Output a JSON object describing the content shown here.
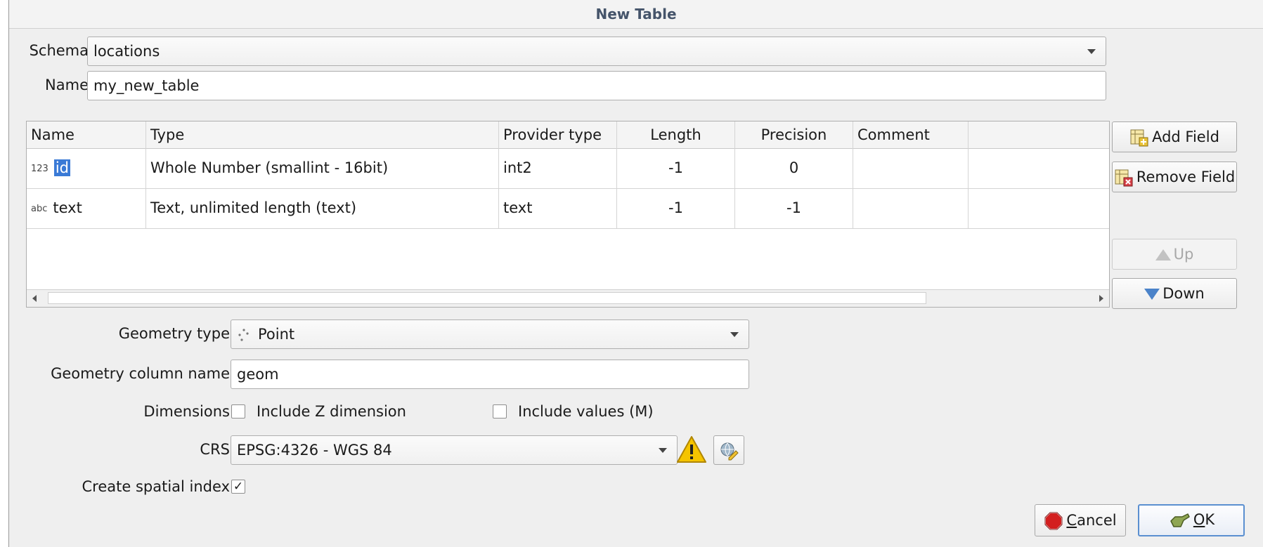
{
  "window": {
    "title": "New Table"
  },
  "schema": {
    "label": "Schema",
    "value": "locations"
  },
  "name": {
    "label": "Name",
    "value": "my_new_table"
  },
  "fields_table": {
    "headers": [
      "Name",
      "Type",
      "Provider type",
      "Length",
      "Precision",
      "Comment"
    ],
    "rows": [
      {
        "type_icon": "123",
        "name": "id",
        "type": "Whole Number (smallint - 16bit)",
        "provider_type": "int2",
        "length": "-1",
        "precision": "0",
        "comment": ""
      },
      {
        "type_icon": "abc",
        "name": "text",
        "type": "Text, unlimited length (text)",
        "provider_type": "text",
        "length": "-1",
        "precision": "-1",
        "comment": ""
      }
    ]
  },
  "buttons": {
    "add_field": "Add Field",
    "remove_field": "Remove Field",
    "up": "Up",
    "down": "Down",
    "cancel_prefix": "",
    "cancel_mnemonic": "C",
    "cancel_rest": "ancel",
    "ok_mnemonic": "O",
    "ok_rest": "K"
  },
  "geometry_type": {
    "label": "Geometry type",
    "value": "Point"
  },
  "geometry_column": {
    "label": "Geometry column name",
    "value": "geom"
  },
  "dimensions": {
    "label": "Dimensions",
    "z_label": "Include Z dimension",
    "z_checked": false,
    "m_label": "Include values (M)",
    "m_checked": false
  },
  "crs": {
    "label": "CRS",
    "value": "EPSG:4326 - WGS 84"
  },
  "spatial_index": {
    "label": "Create spatial index",
    "checked": true,
    "check_glyph": "✓"
  },
  "colors": {
    "accent": "#3a7ad6",
    "warning": "#f5c400",
    "stop": "#d31f1f",
    "title": "#45546a"
  }
}
